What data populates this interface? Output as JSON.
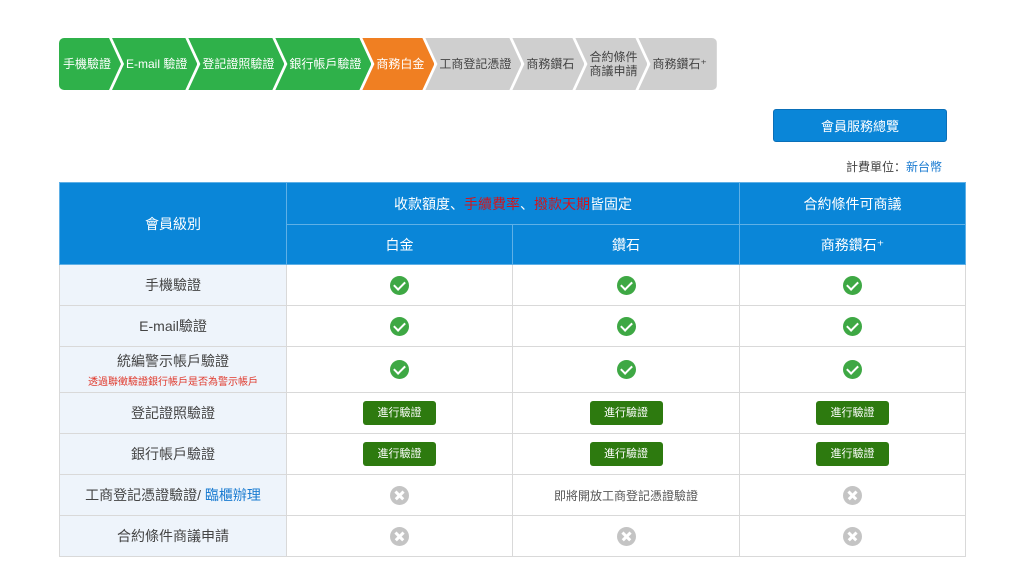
{
  "steps": [
    {
      "label": "手機驗證",
      "state": "done"
    },
    {
      "label": "E-mail 驗證",
      "state": "done"
    },
    {
      "label": "登記證照驗證",
      "state": "done"
    },
    {
      "label": "銀行帳戶驗證",
      "state": "done"
    },
    {
      "label": "商務白金",
      "state": "current"
    },
    {
      "label": "工商登記憑證",
      "state": "todo"
    },
    {
      "label": "商務鑽石",
      "state": "todo"
    },
    {
      "label": "合約條件\n商議申請",
      "state": "todo"
    },
    {
      "label": "商務鑽石⁺",
      "state": "todo"
    }
  ],
  "overview_button": "會員服務總覽",
  "currency": {
    "label": "計費單位：",
    "value": "新台幣"
  },
  "table": {
    "level_header": "會員級別",
    "group_fixed": {
      "pre": "收款額度、",
      "red1": "手續費率",
      "mid": "、",
      "red2": "撥款天期",
      "post": "皆固定"
    },
    "group_negotiable": "合約條件可商議",
    "tiers": [
      "白金",
      "鑽石",
      "商務鑽石⁺"
    ],
    "rows": [
      {
        "label": "手機驗證",
        "cells": [
          "check",
          "check",
          "check"
        ]
      },
      {
        "label": "E-mail驗證",
        "cells": [
          "check",
          "check",
          "check"
        ]
      },
      {
        "label": "統編警示帳戶驗證",
        "note": "透過聯徵驗證銀行帳戶是否為警示帳戶",
        "cells": [
          "check",
          "check",
          "check"
        ]
      },
      {
        "label": "登記證照驗證",
        "cells": [
          "button",
          "button",
          "button"
        ]
      },
      {
        "label": "銀行帳戶驗證",
        "cells": [
          "button",
          "button",
          "button"
        ]
      },
      {
        "label": "工商登記憑證驗證/ ",
        "link": "臨櫃辦理",
        "cells": [
          "cross",
          "text",
          "cross"
        ],
        "text": "即將開放工商登記憑證驗證"
      },
      {
        "label": "合約條件商議申請",
        "cells": [
          "cross",
          "cross",
          "cross"
        ]
      }
    ],
    "verify_button": "進行驗證"
  },
  "colors": {
    "done": "#2fb14a",
    "current": "#f07f22",
    "todo": "#cfcfcf",
    "header": "#0a86d8",
    "button": "#2d7a0f"
  },
  "icons": {
    "check": "check-circle-icon",
    "cross": "x-circle-icon"
  }
}
